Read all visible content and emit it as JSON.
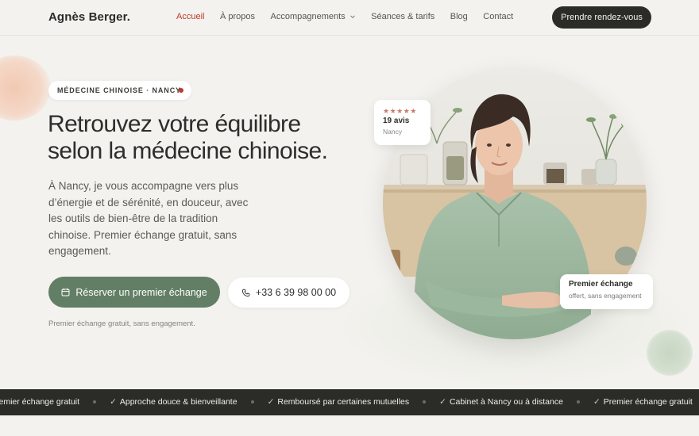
{
  "header": {
    "logo": "Agnès Berger.",
    "nav": [
      {
        "label": "Accueil",
        "active": true
      },
      {
        "label": "À propos"
      },
      {
        "label": "Accompagnements",
        "dropdown": true
      },
      {
        "label": "Séances & tarifs"
      },
      {
        "label": "Blog"
      },
      {
        "label": "Contact"
      }
    ],
    "cta": "Prendre rendez-vous"
  },
  "hero": {
    "badge": "MÉDECINE CHINOISE · NANCY",
    "title_line1": "Retrouvez votre équilibre",
    "title_line2": "selon la médecine chinoise.",
    "text": "À Nancy, je vous accompagne vers plus d’énergie et de sérénité, en douceur, avec les outils de bien-être de la tradition chinoise. Premier échange gratuit, sans engagement.",
    "primary_button": "Réserver un premier échange",
    "phone_button": "+33 6 39 98 00 00",
    "note": "Premier échange gratuit, sans engagement."
  },
  "reviews_card": {
    "stars": "★★★★★",
    "count": "19 avis",
    "city": "Nancy"
  },
  "exchange_card": {
    "title": "Premier échange",
    "subtitle": "offert, sans engagement"
  },
  "marquee": {
    "items": [
      {
        "label": "remier échange gratuit",
        "check": false
      },
      {
        "label": "Approche douce & bienveillante",
        "check": true
      },
      {
        "label": "Remboursé par certaines mutuelles",
        "check": true
      },
      {
        "label": "Cabinet à Nancy ou à distance",
        "check": true
      },
      {
        "label": "Premier échange gratuit",
        "check": true
      }
    ]
  },
  "colors": {
    "accent_red": "#c0392b",
    "sage_green": "#627f66",
    "dark": "#2b2c28",
    "background": "#f3f2ee"
  }
}
